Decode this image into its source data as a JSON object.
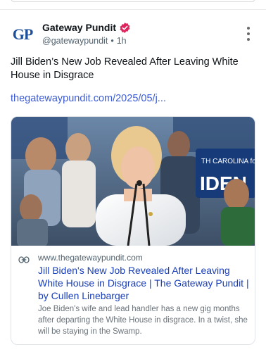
{
  "post": {
    "author_avatar_text": "GP",
    "author_name": "Gateway Pundit",
    "author_handle": "@gatewaypundit",
    "separator": "•",
    "time": "1h",
    "text": "Jill Biden’s New Job Revealed After Leaving White House in Disgrace",
    "link_text": "thegatewaypundit.com/2025/05/j..."
  },
  "card": {
    "domain": "www.thegatewaypundit.com",
    "title": "Jill Biden's New Job Revealed After Leaving White House in Disgrace | The Gateway Pundit | by Cullen Linebarger",
    "description": "Joe Biden's wife and lead handler has a new gig months after departing the White House in disgrace. In a twist, she will be staying in the Swamp.",
    "sign_text_top": "TH CAROLINA for",
    "sign_text_bottom": "IDEN"
  },
  "colors": {
    "link": "#3b5bd6",
    "card_title": "#1a3fb8",
    "verified_badge": "#e0245e",
    "avatar_text": "#1d4f9c"
  },
  "icons": {
    "verified": "verified-badge-icon",
    "more": "more-options-icon",
    "link": "link-icon"
  }
}
